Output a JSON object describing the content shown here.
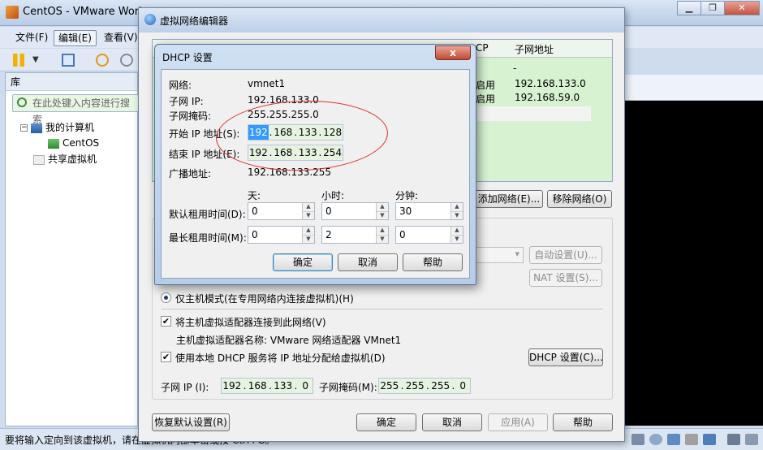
{
  "main_window": {
    "title": "CentOS - VMware Work",
    "menu": [
      "文件(F)",
      "编辑(E)",
      "查看(V)"
    ],
    "library": {
      "header": "库",
      "search_placeholder": "在此处键入内容进行搜索",
      "tree": [
        {
          "label": "我的计算机",
          "expander": "−"
        },
        {
          "label": "CentOS"
        },
        {
          "label": "共享虚拟机"
        }
      ]
    },
    "status_text": "要将输入定向到该虚拟机，请在虚拟机内部单击或按 Ctrl+G。"
  },
  "network_editor": {
    "title": "虚拟网络编辑器",
    "table": {
      "columns": [
        "CP",
        "子网地址"
      ],
      "rows": [
        {
          "dhcp": "",
          "subnet": "-"
        },
        {
          "dhcp": "启用",
          "subnet": "192.168.133.0"
        },
        {
          "dhcp": "启用",
          "subnet": "192.168.59.0"
        }
      ]
    },
    "add_network_button": "添加网络(E)...",
    "remove_network_button": "移除网络(O)",
    "auto_setup_button": "自动设置(U)...",
    "nat_settings_button": "NAT 设置(S)...",
    "host_only_label": "仅主机模式(在专用网络内连接虚拟机)(H)",
    "connect_adapter_label": "将主机虚拟适配器连接到此网络(V)",
    "adapter_name_label": "主机虚拟适配器名称: VMware 网络适配器 VMnet1",
    "use_dhcp_label": "使用本地 DHCP 服务将 IP 地址分配给虚拟机(D)",
    "dhcp_settings_button": "DHCP 设置(C)...",
    "subnet_ip_label": "子网 IP (I):",
    "subnet_ip": [
      "192",
      "168",
      "133",
      "0"
    ],
    "subnet_mask_label": "子网掩码(M):",
    "subnet_mask": [
      "255",
      "255",
      "255",
      "0"
    ],
    "restore_defaults_button": "恢复默认设置(R)",
    "ok_button": "确定",
    "cancel_button": "取消",
    "apply_button": "应用(A)",
    "help_button": "帮助"
  },
  "dhcp_dialog": {
    "title": "DHCP 设置",
    "close_label": "x",
    "network_label": "网络:",
    "network_value": "vmnet1",
    "subnet_ip_label": "子网 IP:",
    "subnet_ip_value": "192.168.133.0",
    "subnet_mask_label": "子网掩码:",
    "subnet_mask_value": "255.255.255.0",
    "start_ip_label": "开始 IP 地址(S):",
    "start_ip": [
      "192",
      "168",
      "133",
      "128"
    ],
    "end_ip_label": "结束 IP 地址(E):",
    "end_ip": [
      "192",
      "168",
      "133",
      "254"
    ],
    "broadcast_label": "广播地址:",
    "broadcast_value": "192.168.133.255",
    "days_label": "天:",
    "hours_label": "小时:",
    "minutes_label": "分钟:",
    "default_lease_label": "默认租用时间(D):",
    "default_lease": {
      "days": "0",
      "hours": "0",
      "minutes": "30"
    },
    "max_lease_label": "最长租用时间(M):",
    "max_lease": {
      "days": "0",
      "hours": "2",
      "minutes": "0"
    },
    "ok_button": "确定",
    "cancel_button": "取消",
    "help_button": "帮助"
  },
  "colors": {
    "table_bg": "#d6f2d1",
    "ip_field_bg": "#e6f3e0",
    "annotation_oval": "#d9302a",
    "selection": "#3399ff"
  }
}
